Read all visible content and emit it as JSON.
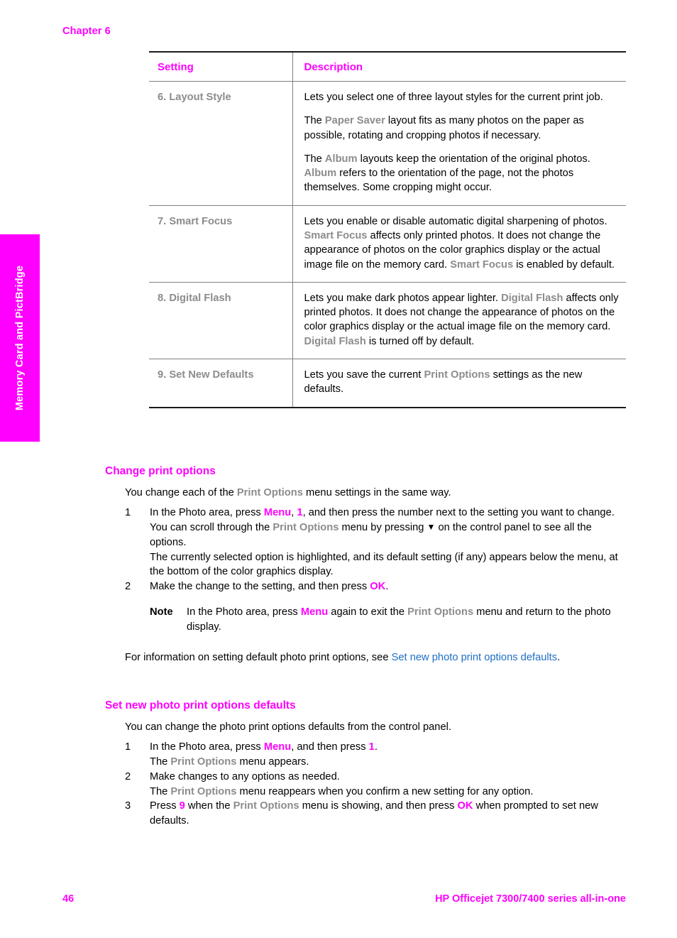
{
  "page": {
    "chapter_label": "Chapter 6",
    "side_tab_label": "Memory Card and PictBridge",
    "footer_page_number": "46",
    "footer_product": "HP Officejet 7300/7400 series all-in-one"
  },
  "colors": {
    "accent_magenta": "#ff00ff",
    "ui_term_gray": "#8c8c8c",
    "cross_reference_blue": "#1f6fc4",
    "rule_gray": "#808080",
    "rule_black": "#1a1a1a"
  },
  "table": {
    "headers": {
      "setting": "Setting",
      "description": "Description"
    },
    "rows": [
      {
        "setting": "6. Layout Style",
        "paragraphs": [
          {
            "parts": [
              {
                "t": "Lets you select one of three layout styles for the current print job.",
                "s": "plain"
              }
            ]
          },
          {
            "parts": [
              {
                "t": "The ",
                "s": "plain"
              },
              {
                "t": "Paper Saver",
                "s": "ui"
              },
              {
                "t": " layout fits as many photos on the paper as possible, rotating and cropping photos if necessary.",
                "s": "plain"
              }
            ]
          },
          {
            "parts": [
              {
                "t": "The ",
                "s": "plain"
              },
              {
                "t": "Album",
                "s": "ui"
              },
              {
                "t": " layouts keep the orientation of the original photos. ",
                "s": "plain"
              },
              {
                "t": "Album",
                "s": "ui"
              },
              {
                "t": " refers to the orientation of the page, not the photos themselves. Some cropping might occur.",
                "s": "plain"
              }
            ]
          }
        ]
      },
      {
        "setting": "7. Smart Focus",
        "paragraphs": [
          {
            "parts": [
              {
                "t": "Lets you enable or disable automatic digital sharpening of photos. ",
                "s": "plain"
              },
              {
                "t": "Smart Focus",
                "s": "ui"
              },
              {
                "t": " affects only printed photos. It does not change the appearance of photos on the color graphics display or the actual image file on the memory card. ",
                "s": "plain"
              },
              {
                "t": "Smart Focus",
                "s": "ui"
              },
              {
                "t": " is enabled by default.",
                "s": "plain"
              }
            ]
          }
        ]
      },
      {
        "setting": "8. Digital Flash",
        "paragraphs": [
          {
            "parts": [
              {
                "t": "Lets you make dark photos appear lighter. ",
                "s": "plain"
              },
              {
                "t": "Digital Flash",
                "s": "ui"
              },
              {
                "t": " affects only printed photos. It does not change the appearance of photos on the color graphics display or the actual image file on the memory card. ",
                "s": "plain"
              },
              {
                "t": "Digital Flash",
                "s": "ui"
              },
              {
                "t": " is turned off by default.",
                "s": "plain"
              }
            ]
          }
        ]
      },
      {
        "setting": "9. Set New Defaults",
        "paragraphs": [
          {
            "parts": [
              {
                "t": "Lets you save the current ",
                "s": "plain"
              },
              {
                "t": "Print Options",
                "s": "ui"
              },
              {
                "t": " settings as the new defaults.",
                "s": "plain"
              }
            ]
          }
        ]
      }
    ]
  },
  "section_change": {
    "heading": "Change print options",
    "intro": {
      "parts": [
        {
          "t": "You change each of the ",
          "s": "plain"
        },
        {
          "t": "Print Options",
          "s": "ui"
        },
        {
          "t": " menu settings in the same way.",
          "s": "plain"
        }
      ]
    },
    "steps": [
      {
        "num": "1",
        "parts": [
          {
            "t": "In the Photo area, press ",
            "s": "plain"
          },
          {
            "t": "Menu",
            "s": "key"
          },
          {
            "t": ", ",
            "s": "plain"
          },
          {
            "t": "1",
            "s": "key"
          },
          {
            "t": ", and then press the number next to the setting you want to change. You can scroll through the ",
            "s": "plain"
          },
          {
            "t": "Print Options",
            "s": "ui"
          },
          {
            "t": " menu by pressing ",
            "s": "plain"
          },
          {
            "t": "▼",
            "s": "tri"
          },
          {
            "t": " on the control panel to see all the options.",
            "s": "plain"
          }
        ],
        "sub_parts": [
          {
            "t": "The currently selected option is highlighted, and its default setting (if any) appears below the menu, at the bottom of the color graphics display.",
            "s": "plain"
          }
        ]
      },
      {
        "num": "2",
        "parts": [
          {
            "t": "Make the change to the setting, and then press ",
            "s": "plain"
          },
          {
            "t": "OK",
            "s": "key"
          },
          {
            "t": ".",
            "s": "plain"
          }
        ]
      }
    ],
    "note": {
      "label": "Note",
      "parts": [
        {
          "t": "In the Photo area, press ",
          "s": "plain"
        },
        {
          "t": "Menu",
          "s": "key"
        },
        {
          "t": " again to exit the ",
          "s": "plain"
        },
        {
          "t": "Print Options",
          "s": "ui"
        },
        {
          "t": " menu and return to the photo display.",
          "s": "plain"
        }
      ]
    },
    "outro": {
      "parts": [
        {
          "t": "For information on setting default photo print options, see ",
          "s": "plain"
        },
        {
          "t": "Set new photo print options defaults",
          "s": "xref"
        },
        {
          "t": ".",
          "s": "plain"
        }
      ]
    }
  },
  "section_defaults": {
    "heading": "Set new photo print options defaults",
    "intro": {
      "parts": [
        {
          "t": "You can change the photo print options defaults from the control panel.",
          "s": "plain"
        }
      ]
    },
    "steps": [
      {
        "num": "1",
        "parts": [
          {
            "t": "In the Photo area, press ",
            "s": "plain"
          },
          {
            "t": "Menu",
            "s": "key"
          },
          {
            "t": ", and then press ",
            "s": "plain"
          },
          {
            "t": "1",
            "s": "key"
          },
          {
            "t": ".",
            "s": "plain"
          }
        ],
        "sub_parts": [
          {
            "t": "The ",
            "s": "plain"
          },
          {
            "t": "Print Options",
            "s": "ui"
          },
          {
            "t": " menu appears.",
            "s": "plain"
          }
        ]
      },
      {
        "num": "2",
        "parts": [
          {
            "t": "Make changes to any options as needed.",
            "s": "plain"
          }
        ],
        "sub_parts": [
          {
            "t": "The ",
            "s": "plain"
          },
          {
            "t": "Print Options",
            "s": "ui"
          },
          {
            "t": " menu reappears when you confirm a new setting for any option.",
            "s": "plain"
          }
        ]
      },
      {
        "num": "3",
        "parts": [
          {
            "t": "Press ",
            "s": "plain"
          },
          {
            "t": "9",
            "s": "key"
          },
          {
            "t": " when the ",
            "s": "plain"
          },
          {
            "t": "Print Options",
            "s": "ui"
          },
          {
            "t": " menu is showing, and then press ",
            "s": "plain"
          },
          {
            "t": "OK",
            "s": "key"
          },
          {
            "t": " when prompted to set new defaults.",
            "s": "plain"
          }
        ]
      }
    ]
  }
}
